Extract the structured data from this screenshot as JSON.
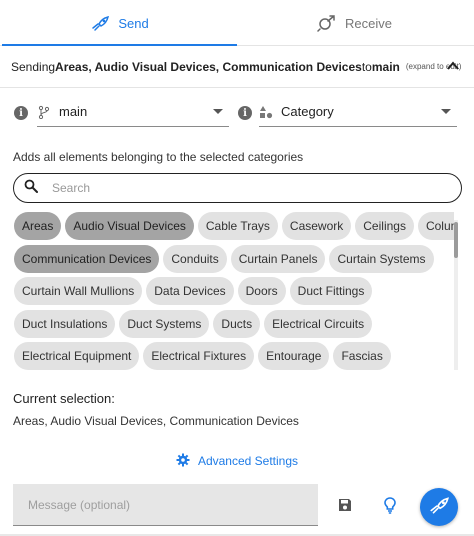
{
  "tabs": [
    {
      "label": "Send",
      "icon": "send-rocket-icon",
      "active": true
    },
    {
      "label": "Receive",
      "icon": "receive-icon",
      "active": false
    }
  ],
  "summary": {
    "prefix": "Sending ",
    "categories_bold": "Areas, Audio Visual Devices, Communication Devices",
    "middle": " to ",
    "branch_bold": "main",
    "expand_hint": "(expand to edit)"
  },
  "branch_select": {
    "value": "main",
    "icon": "git-branch-icon"
  },
  "filter_select": {
    "value": "Category",
    "icon": "category-shapes-icon"
  },
  "hint": "Adds all elements belonging to the selected categories",
  "search": {
    "placeholder": "Search",
    "value": ""
  },
  "chips": [
    [
      {
        "label": "Areas",
        "selected": true
      },
      {
        "label": "Audio Visual Devices",
        "selected": true
      },
      {
        "label": "Cable Trays",
        "selected": false
      },
      {
        "label": "Casework",
        "selected": false
      },
      {
        "label": "Ceilings",
        "selected": false
      },
      {
        "label": "Columns",
        "selected": false
      }
    ],
    [
      {
        "label": "Communication Devices",
        "selected": true
      },
      {
        "label": "Conduits",
        "selected": false
      },
      {
        "label": "Curtain Panels",
        "selected": false
      },
      {
        "label": "Curtain Systems",
        "selected": false
      }
    ],
    [
      {
        "label": "Curtain Wall Mullions",
        "selected": false
      },
      {
        "label": "Data Devices",
        "selected": false
      },
      {
        "label": "Doors",
        "selected": false
      },
      {
        "label": "Duct Fittings",
        "selected": false
      }
    ],
    [
      {
        "label": "Duct Insulations",
        "selected": false
      },
      {
        "label": "Duct Systems",
        "selected": false
      },
      {
        "label": "Ducts",
        "selected": false
      },
      {
        "label": "Electrical Circuits",
        "selected": false
      }
    ],
    [
      {
        "label": "Electrical Equipment",
        "selected": false
      },
      {
        "label": "Electrical Fixtures",
        "selected": false
      },
      {
        "label": "Entourage",
        "selected": false
      },
      {
        "label": "Fascias",
        "selected": false
      }
    ]
  ],
  "current_selection": {
    "label": "Current selection:",
    "value": "Areas, Audio Visual Devices, Communication Devices"
  },
  "advanced_settings": {
    "label": "Advanced Settings",
    "icon": "gear-icon"
  },
  "message": {
    "placeholder": "Message (optional)",
    "value": ""
  },
  "actions": {
    "save_icon": "save-floppy-icon",
    "tip_icon": "lightbulb-icon",
    "send_icon": "send-rocket-icon"
  },
  "colors": {
    "accent": "#1e7be6",
    "chip": "#e2e2e2",
    "chip_selected": "#a4a4a4",
    "message_bg": "#e6e6e6"
  }
}
